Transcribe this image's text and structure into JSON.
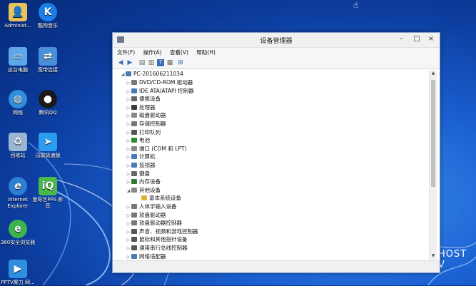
{
  "desktop": {
    "icons": [
      {
        "label": "Administ...",
        "icon": "folder-user-icon"
      },
      {
        "label": "酷狗音乐",
        "icon": "kugou-icon"
      },
      {
        "label": "这台电脑",
        "icon": "computer-icon"
      },
      {
        "label": "宽带连接",
        "icon": "network-connection-icon"
      },
      {
        "label": "网络",
        "icon": "network-globe-icon"
      },
      {
        "label": "腾讯QQ",
        "icon": "qq-penguin-icon"
      },
      {
        "label": "回收站",
        "icon": "recycle-bin-icon"
      },
      {
        "label": "迅雷极速版",
        "icon": "xunlei-bird-icon"
      },
      {
        "label": "Internet Explorer",
        "icon": "ie-icon"
      },
      {
        "label": "爱奇艺PPS 影音",
        "icon": "iqiyi-pps-icon"
      },
      {
        "label": "360安全浏览器",
        "icon": "360-browser-icon"
      },
      {
        "label": "PPTV聚力 网...",
        "icon": "pptv-icon"
      }
    ],
    "wallpaper_text": "HOST V",
    "colors": {
      "wallpaper": "#1a5fd0",
      "accent": "#3a6fb0"
    }
  },
  "window": {
    "title": "设备管理器",
    "controls": {
      "minimize": "–",
      "maximize": "□",
      "close": "×"
    },
    "menu": [
      "文件(F)",
      "操作(A)",
      "查看(V)",
      "帮助(H)"
    ],
    "tree": {
      "root": "PC-201606211034",
      "items": [
        {
          "label": "DVD/CD-ROM 驱动器",
          "expander": "▷",
          "color": "#777"
        },
        {
          "label": "IDE ATA/ATAPI 控制器",
          "expander": "▷",
          "color": "#4a7bb7"
        },
        {
          "label": "便携设备",
          "expander": "▷",
          "color": "#666"
        },
        {
          "label": "处理器",
          "expander": "▷",
          "color": "#3b3b3b"
        },
        {
          "label": "磁盘驱动器",
          "expander": "▷",
          "color": "#888"
        },
        {
          "label": "存储控制器",
          "expander": "▷",
          "color": "#777"
        },
        {
          "label": "打印队列",
          "expander": "▷",
          "color": "#555"
        },
        {
          "label": "电池",
          "expander": "▷",
          "color": "#2e8b2e"
        },
        {
          "label": "端口 (COM 和 LPT)",
          "expander": "▷",
          "color": "#888"
        },
        {
          "label": "计算机",
          "expander": "▷",
          "color": "#4a7bb7"
        },
        {
          "label": "监视器",
          "expander": "▷",
          "color": "#4a7bb7"
        },
        {
          "label": "键盘",
          "expander": "▷",
          "color": "#666"
        },
        {
          "label": "内存设备",
          "expander": "▷",
          "color": "#2e7d32"
        },
        {
          "label": "其他设备",
          "expander": "◢",
          "color": "#888"
        },
        {
          "label": "基本系统设备",
          "expander": "",
          "color": "#e0b030",
          "child": true
        },
        {
          "label": "人体学输入设备",
          "expander": "▷",
          "color": "#777"
        },
        {
          "label": "软盘驱动器",
          "expander": "▷",
          "color": "#777"
        },
        {
          "label": "软盘驱动器控制器",
          "expander": "▷",
          "color": "#777"
        },
        {
          "label": "声音、视频和游戏控制器",
          "expander": "▷",
          "color": "#555"
        },
        {
          "label": "鼠标和其他指针设备",
          "expander": "▷",
          "color": "#555"
        },
        {
          "label": "通用串行总线控制器",
          "expander": "▷",
          "color": "#555"
        },
        {
          "label": "网络适配器",
          "expander": "▷",
          "color": "#4a7bb7"
        }
      ]
    }
  }
}
